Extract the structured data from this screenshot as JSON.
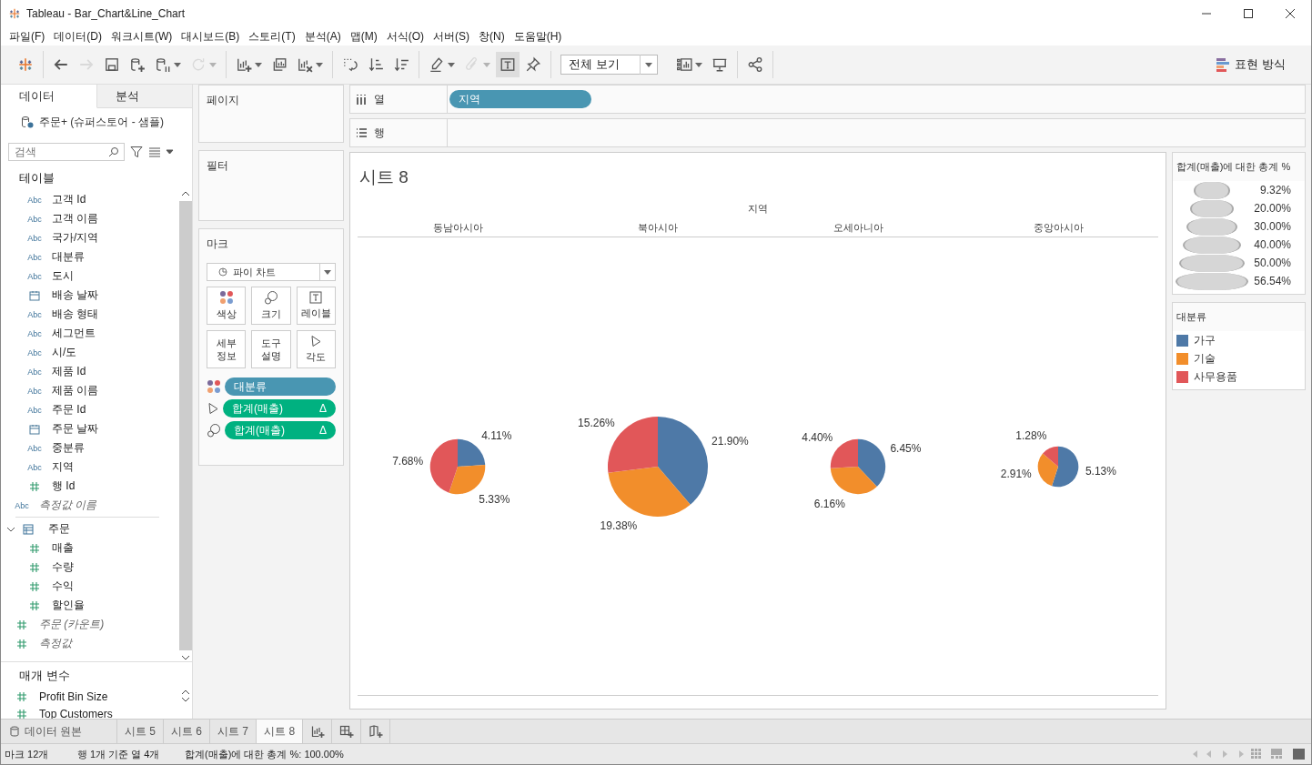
{
  "window": {
    "title": "Tableau - Bar_Chart&Line_Chart"
  },
  "menu": [
    "파일(F)",
    "데이터(D)",
    "워크시트(W)",
    "대시보드(B)",
    "스토리(T)",
    "분석(A)",
    "맵(M)",
    "서식(O)",
    "서버(S)",
    "창(N)",
    "도움말(H)"
  ],
  "toolbar": {
    "left_groups": [
      [
        {
          "kind": "logo",
          "disabled": false,
          "selected": false,
          "dropdown": false
        }
      ],
      [
        {
          "kind": "back",
          "disabled": false,
          "selected": false,
          "dropdown": false
        },
        {
          "kind": "forward",
          "disabled": true,
          "selected": false,
          "dropdown": false
        },
        {
          "kind": "save",
          "disabled": false,
          "selected": false,
          "dropdown": false
        },
        {
          "kind": "new-data",
          "disabled": false,
          "selected": false,
          "dropdown": false
        },
        {
          "kind": "pause-data",
          "disabled": false,
          "selected": false,
          "dropdown": true
        },
        {
          "kind": "refresh",
          "disabled": true,
          "selected": false,
          "dropdown": true
        }
      ],
      [
        {
          "kind": "new-sheet",
          "disabled": false,
          "selected": false,
          "dropdown": true
        },
        {
          "kind": "duplicate",
          "disabled": false,
          "selected": false,
          "dropdown": false
        },
        {
          "kind": "clear",
          "disabled": false,
          "selected": false,
          "dropdown": true
        }
      ],
      [
        {
          "kind": "swap",
          "disabled": false,
          "selected": false,
          "dropdown": false
        },
        {
          "kind": "sort-asc",
          "disabled": false,
          "selected": false,
          "dropdown": false
        },
        {
          "kind": "sort-desc",
          "disabled": false,
          "selected": false,
          "dropdown": false
        }
      ],
      [
        {
          "kind": "highlight",
          "disabled": false,
          "selected": false,
          "dropdown": true
        },
        {
          "kind": "group",
          "disabled": true,
          "selected": false,
          "dropdown": true
        },
        {
          "kind": "labels",
          "disabled": false,
          "selected": true,
          "dropdown": false
        },
        {
          "kind": "pin",
          "disabled": false,
          "selected": false,
          "dropdown": false
        }
      ]
    ],
    "fit": "전체 보기",
    "right_groups": [
      [
        {
          "kind": "cards",
          "disabled": false,
          "selected": false,
          "dropdown": true
        },
        {
          "kind": "presentation",
          "disabled": false,
          "selected": false,
          "dropdown": false
        }
      ],
      [
        {
          "kind": "share",
          "disabled": false,
          "selected": false,
          "dropdown": false
        }
      ]
    ],
    "show_me": "표현 방식"
  },
  "data_pane": {
    "tabs": [
      {
        "label": "데이터",
        "selected": true
      },
      {
        "label": "분석",
        "selected": false
      }
    ],
    "datasource": "주문+ (슈퍼스토어 - 샘플)",
    "search": {
      "placeholder": "검색"
    },
    "tables_heading": "테이블",
    "fields": [
      {
        "kind": "text",
        "icon_text": "Abc",
        "label": "고객 Id",
        "generated": false
      },
      {
        "kind": "text",
        "icon_text": "Abc",
        "label": "고객 이름",
        "generated": false
      },
      {
        "kind": "text",
        "icon_text": "Abc",
        "label": "국가/지역",
        "generated": false
      },
      {
        "kind": "text",
        "icon_text": "Abc",
        "label": "대분류",
        "generated": false
      },
      {
        "kind": "text",
        "icon_text": "Abc",
        "label": "도시",
        "generated": false
      },
      {
        "kind": "date",
        "label": "배송 날짜",
        "generated": false
      },
      {
        "kind": "text",
        "icon_text": "Abc",
        "label": "배송 형태",
        "generated": false
      },
      {
        "kind": "text",
        "icon_text": "Abc",
        "label": "세그먼트",
        "generated": false
      },
      {
        "kind": "text",
        "icon_text": "Abc",
        "label": "시/도",
        "generated": false
      },
      {
        "kind": "text",
        "icon_text": "Abc",
        "label": "제품 Id",
        "generated": false
      },
      {
        "kind": "text",
        "icon_text": "Abc",
        "label": "제품 이름",
        "generated": false
      },
      {
        "kind": "text",
        "icon_text": "Abc",
        "label": "주문 Id",
        "generated": false
      },
      {
        "kind": "date",
        "label": "주문 날짜",
        "generated": false
      },
      {
        "kind": "text",
        "icon_text": "Abc",
        "label": "중분류",
        "generated": false
      },
      {
        "kind": "text",
        "icon_text": "Abc",
        "label": "지역",
        "generated": false
      },
      {
        "kind": "number",
        "label": "행 Id",
        "generated": false
      }
    ],
    "extra_fields": [
      {
        "kind": "text",
        "icon_text": "Abc",
        "label": "측정값 이름",
        "generated": true
      }
    ],
    "folders": [
      {
        "label": "주문",
        "expanded": true,
        "children": [
          {
            "kind": "number",
            "label": "매출",
            "generated": false
          },
          {
            "kind": "number",
            "label": "수량",
            "generated": false
          },
          {
            "kind": "number",
            "label": "수익",
            "generated": false
          },
          {
            "kind": "number",
            "label": "할인율",
            "generated": false
          }
        ]
      }
    ],
    "generated_measures": [
      {
        "kind": "number",
        "label": "주문 (카운트)",
        "generated": true
      },
      {
        "kind": "number",
        "label": "측정값",
        "generated": true
      }
    ],
    "parameters_heading": "매개 변수",
    "parameters": [
      {
        "kind": "number",
        "label": "Profit Bin Size"
      },
      {
        "kind": "number",
        "label": "Top Customers"
      }
    ]
  },
  "pages": {
    "title": "페이지"
  },
  "filters": {
    "title": "필터"
  },
  "marks": {
    "title": "마크",
    "mark_type": "파이 차트",
    "buttons": [
      {
        "kind": "color",
        "label": "색상"
      },
      {
        "kind": "size",
        "label": "크기"
      },
      {
        "kind": "label",
        "label": "레이블"
      },
      {
        "kind": "detail",
        "label": "세부 정보"
      },
      {
        "kind": "tooltip",
        "label": "도구 설명"
      },
      {
        "kind": "angle",
        "label": "각도"
      }
    ],
    "pills": [
      {
        "encoding": {
          "kind": "color"
        },
        "label": "대분류",
        "kind": "dimension"
      },
      {
        "encoding": {
          "kind": "angle"
        },
        "label": "합계(매출)",
        "kind": "measure",
        "table_calc": "Δ"
      },
      {
        "encoding": {
          "kind": "size"
        },
        "label": "합계(매출)",
        "kind": "measure",
        "table_calc": "Δ"
      }
    ]
  },
  "shelves": [
    {
      "kind": "columns",
      "label": "열",
      "pills": [
        {
          "label": "지역",
          "kind": "dimension"
        }
      ]
    },
    {
      "kind": "rows",
      "label": "행"
    }
  ],
  "view": {
    "title": "시트 8",
    "column_header": "지역",
    "columns": [
      {
        "label": "동남아시아",
        "chart_data": {
          "type": "pie",
          "values": [
            4.11,
            5.33,
            7.68
          ],
          "value_labels": [
            "4.11%",
            "5.33%",
            "7.68%"
          ]
        }
      },
      {
        "label": "북아시아",
        "chart_data": {
          "type": "pie",
          "values": [
            21.9,
            19.38,
            15.26
          ],
          "value_labels": [
            "21.90%",
            "19.38%",
            "15.26%"
          ]
        }
      },
      {
        "label": "오세아니아",
        "chart_data": {
          "type": "pie",
          "values": [
            6.45,
            6.16,
            4.4
          ],
          "value_labels": [
            "6.45%",
            "6.16%",
            "4.40%"
          ]
        }
      },
      {
        "label": "중앙아시아",
        "chart_data": {
          "type": "pie",
          "values": [
            5.13,
            2.91,
            1.28
          ],
          "value_labels": [
            "5.13%",
            "2.91%",
            "1.28%"
          ]
        }
      }
    ]
  },
  "size_legend": {
    "title": "합계(매출)에 대한 총계 %",
    "items": [
      "9.32%",
      "20.00%",
      "30.00%",
      "40.00%",
      "50.00%",
      "56.54%"
    ]
  },
  "color_legend": {
    "title": "대분류",
    "items": [
      {
        "label": "가구",
        "color": "#4e79a7"
      },
      {
        "label": "기술",
        "color": "#f28e2b"
      },
      {
        "label": "사무용품",
        "color": "#e15759"
      }
    ]
  },
  "sheet_tabs": [
    {
      "kind": "datasource",
      "label": "데이터 원본",
      "selected": false
    },
    {
      "kind": "sheet",
      "label": "시트 5",
      "selected": false
    },
    {
      "kind": "sheet",
      "label": "시트 6",
      "selected": false
    },
    {
      "kind": "sheet",
      "label": "시트 7",
      "selected": false
    },
    {
      "kind": "sheet",
      "label": "시트 8",
      "selected": true
    }
  ],
  "status_bar": [
    "마크 12개",
    "행 1개 기준 열 4개",
    "합계(매출)에 대한 총계 %: 100.00%"
  ]
}
